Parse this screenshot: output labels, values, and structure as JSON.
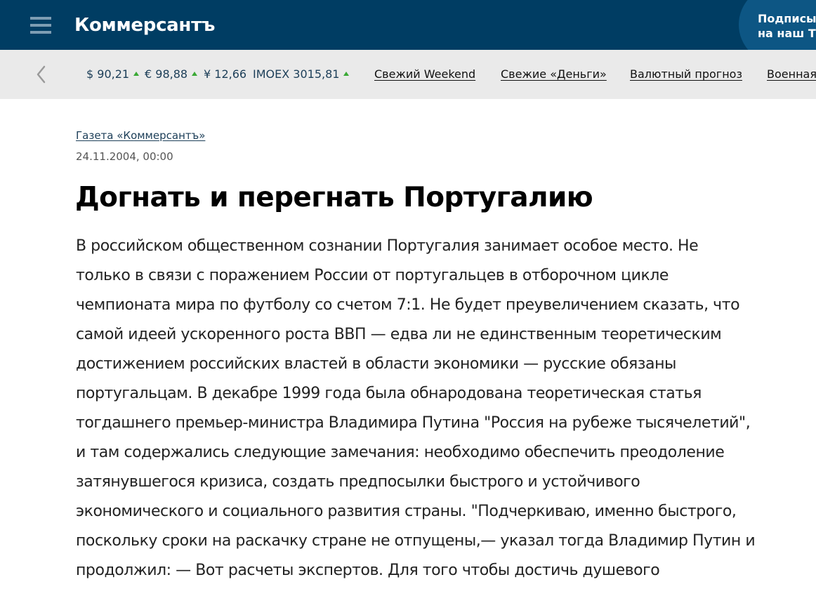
{
  "header": {
    "logo": "Коммерсантъ",
    "subscribe_line1": "Подписыв",
    "subscribe_line2": "на наш Те"
  },
  "ticker": {
    "rates": [
      {
        "label": "$ 90,21",
        "trend": "up"
      },
      {
        "label": "€ 98,88",
        "trend": "up"
      },
      {
        "label": "¥ 12,66",
        "trend": "none"
      },
      {
        "label": "IMOEX 3015,81",
        "trend": "up"
      }
    ],
    "links": [
      "Свежий Weekend",
      "Свежие «Деньги»",
      "Валютный прогноз",
      "Военная"
    ]
  },
  "article": {
    "source": "Газета «Коммерсантъ»",
    "date": "24.11.2004, 00:00",
    "title": "Догнать и перегнать Португалию",
    "body_lines": [
      "В российском общественном сознании Португалия занимает особое место. Не",
      "только в связи с поражением России от португальцев в отборочном цикле",
      "чемпионата мира по футболу со счетом 7:1. Не будет преувеличением сказать, что",
      "самой идеей ускоренного роста ВВП — едва ли не единственным теоретическим",
      "достижением российских властей в области экономики — русские обязаны",
      "португальцам. В декабре 1999 года была обнародована теоретическая статья",
      "тогдашнего премьер-министра Владимира Путина \"Россия на рубеже тысячелетий\",",
      "и там содержались следующие замечания: необходимо обеспечить преодоление",
      "затянувшегося кризиса, создать предпосылки быстрого и устойчивого",
      "экономического и социального развития страны. \"Подчеркиваю, именно быстрого,",
      "поскольку сроки на раскачку стране не отпущены,— указал тогда Владимир Путин и",
      "продолжил: — Вот расчеты экспертов. Для того чтобы достичь душевого"
    ]
  },
  "colors": {
    "header_bg": "#003d63",
    "ticker_bg": "#eaeaea",
    "trend_up": "#3aa935"
  },
  "icons": {
    "menu": "hamburger-menu-icon",
    "ticker_prev": "chevron-left-icon",
    "trend_up": "triangle-up-icon"
  }
}
